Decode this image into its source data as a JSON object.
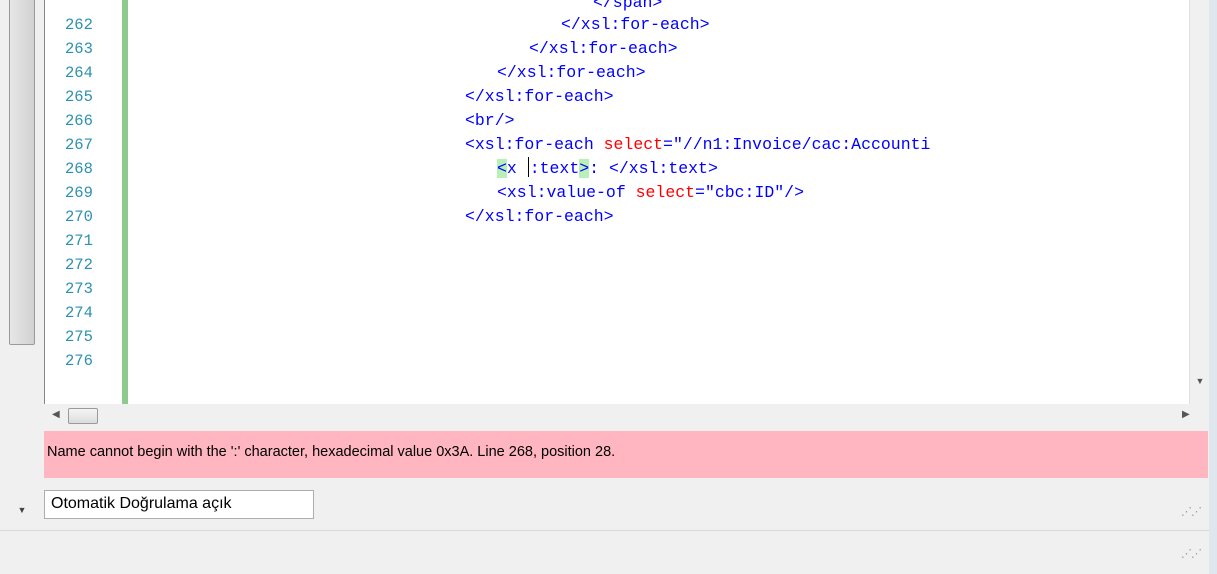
{
  "editor": {
    "line_numbers": [
      "262",
      "263",
      "264",
      "265",
      "266",
      "267",
      "268",
      "269",
      "270",
      "271",
      "272",
      "273",
      "274",
      "275",
      "276"
    ],
    "code_lines": [
      [
        {
          "t": "tb",
          "v": "</xsl:for-each>"
        }
      ],
      [
        {
          "t": "tb",
          "v": "</xsl:for-each>"
        }
      ],
      [
        {
          "t": "tb",
          "v": "</xsl:for-each>"
        }
      ],
      [
        {
          "t": "tb",
          "v": "</xsl:for-each>"
        }
      ],
      [
        {
          "t": "tb",
          "v": "<br/>"
        }
      ],
      [
        {
          "t": "tb",
          "v": "<xsl:for-each "
        },
        {
          "t": "attr",
          "v": "select"
        },
        {
          "t": "tb",
          "v": "="
        },
        {
          "t": "val",
          "v": "\"//n1:Invoice/cac:Accounti"
        }
      ],
      [
        {
          "t": "hl",
          "v": "<"
        },
        {
          "t": "tb",
          "v": "x "
        },
        {
          "t": "caret",
          "v": ""
        },
        {
          "t": "tb",
          "v": ":text"
        },
        {
          "t": "hl",
          "v": ">"
        },
        {
          "t": "tb",
          "v": ": </xsl:text>"
        }
      ],
      [
        {
          "t": "tb",
          "v": "<xsl:value-of "
        },
        {
          "t": "attr",
          "v": "select"
        },
        {
          "t": "tb",
          "v": "="
        },
        {
          "t": "val",
          "v": "\"cbc:ID\""
        },
        {
          "t": "tb",
          "v": "/>"
        }
      ],
      [
        {
          "t": "tb",
          "v": "</xsl:for-each>"
        }
      ]
    ],
    "partial_top_line": "</span>"
  },
  "error_message": "Name cannot begin with the ':' character, hexadecimal value 0x3A. Line 268, position 28.",
  "validate_button_label": "Otomatik Doğrulama açık",
  "colors": {
    "tag": "#0000ff",
    "attribute": "#ff0000",
    "line_number": "#2b91af",
    "change_bar": "#8ec98e",
    "error_background": "#ffb6c1",
    "bracket_match": "#b8f0b8"
  }
}
